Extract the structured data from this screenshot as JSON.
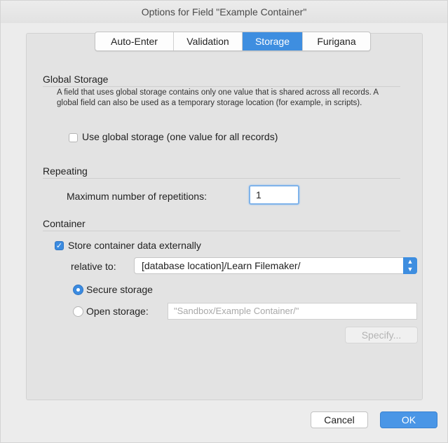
{
  "window": {
    "title": "Options for Field \"Example Container\""
  },
  "tabs": [
    {
      "label": "Auto-Enter",
      "active": false
    },
    {
      "label": "Validation",
      "active": false
    },
    {
      "label": "Storage",
      "active": true
    },
    {
      "label": "Furigana",
      "active": false
    }
  ],
  "global_storage": {
    "title": "Global Storage",
    "description": "A field that uses global storage contains only one value that is shared across all records.  A global field can also be used as a temporary storage location (for example, in scripts).",
    "checkbox_label": "Use global storage (one value for all records)",
    "checked": false
  },
  "repeating": {
    "title": "Repeating",
    "max_label": "Maximum number of repetitions:",
    "max_value": "1"
  },
  "container": {
    "title": "Container",
    "store_external_label": "Store container data externally",
    "store_external_checked": true,
    "relative_label": "relative to:",
    "relative_value": "[database location]/Learn Filemaker/",
    "secure_label": "Secure storage",
    "secure_selected": true,
    "open_label": "Open storage:",
    "open_placeholder": "\"Sandbox/Example Container/\"",
    "specify_label": "Specify..."
  },
  "footer": {
    "cancel_label": "Cancel",
    "ok_label": "OK"
  },
  "colors": {
    "accent": "#3e8ee0",
    "panel": "#e3e3e3",
    "window": "#ececec"
  }
}
